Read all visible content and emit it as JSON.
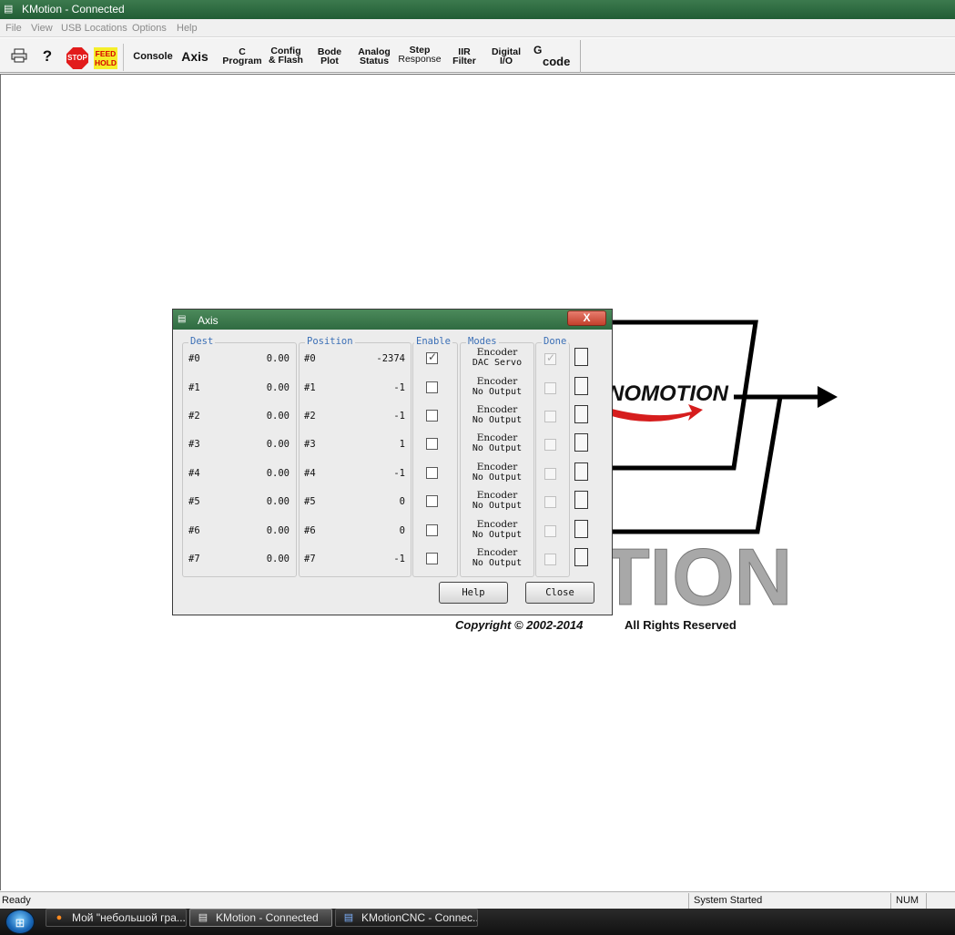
{
  "window": {
    "title": "KMotion - Connected"
  },
  "menu": {
    "items": [
      "File",
      "View",
      "USB Locations",
      "Options",
      "Help"
    ]
  },
  "toolbar": {
    "stop_label": "STOP",
    "feedhold_line1": "FEED",
    "feedhold_line2": "HOLD",
    "help_glyph": "?",
    "console": "Console",
    "axis": "Axis",
    "c_program_1": "C",
    "c_program_2": "Program",
    "config_1": "Config",
    "config_2": "& Flash",
    "bode_1": "Bode",
    "bode_2": "Plot",
    "analog_1": "Analog",
    "analog_2": "Status",
    "step_1": "Step",
    "step_2": "Response",
    "iir_1": "IIR",
    "iir_2": "Filter",
    "digital_1": "Digital",
    "digital_2": "I/O",
    "gcode_1": "G",
    "gcode_2": "code"
  },
  "background": {
    "logo_text": "NOMOTION",
    "big_text": "TION",
    "copyright": "Copyright © 2002-2014",
    "rights": "All Rights Reserved"
  },
  "axis_dialog": {
    "title": "Axis",
    "close_glyph": "X",
    "groups": {
      "dest": "Dest",
      "position": "Position",
      "enable": "Enable",
      "modes": "Modes",
      "done": "Done"
    },
    "rows": [
      {
        "id": "#0",
        "dest": "0.00",
        "pos": "-2374",
        "enabled": true,
        "mode1": "Encoder",
        "mode2": "DAC Servo",
        "done": true
      },
      {
        "id": "#1",
        "dest": "0.00",
        "pos": "-1",
        "enabled": false,
        "mode1": "Encoder",
        "mode2": "No Output",
        "done": false
      },
      {
        "id": "#2",
        "dest": "0.00",
        "pos": "-1",
        "enabled": false,
        "mode1": "Encoder",
        "mode2": "No Output",
        "done": false
      },
      {
        "id": "#3",
        "dest": "0.00",
        "pos": "1",
        "enabled": false,
        "mode1": "Encoder",
        "mode2": "No Output",
        "done": false
      },
      {
        "id": "#4",
        "dest": "0.00",
        "pos": "-1",
        "enabled": false,
        "mode1": "Encoder",
        "mode2": "No Output",
        "done": false
      },
      {
        "id": "#5",
        "dest": "0.00",
        "pos": "0",
        "enabled": false,
        "mode1": "Encoder",
        "mode2": "No Output",
        "done": false
      },
      {
        "id": "#6",
        "dest": "0.00",
        "pos": "0",
        "enabled": false,
        "mode1": "Encoder",
        "mode2": "No Output",
        "done": false
      },
      {
        "id": "#7",
        "dest": "0.00",
        "pos": "-1",
        "enabled": false,
        "mode1": "Encoder",
        "mode2": "No Output",
        "done": false
      }
    ],
    "help_button": "Help",
    "close_button": "Close"
  },
  "status_bar": {
    "left": "Ready",
    "middle": "System Started",
    "num": "NUM"
  },
  "taskbar": {
    "tasks": [
      {
        "label": "Мой \"небольшой гра..."
      },
      {
        "label": "KMotion - Connected"
      },
      {
        "label": "KMotionCNC - Connec..."
      }
    ]
  }
}
